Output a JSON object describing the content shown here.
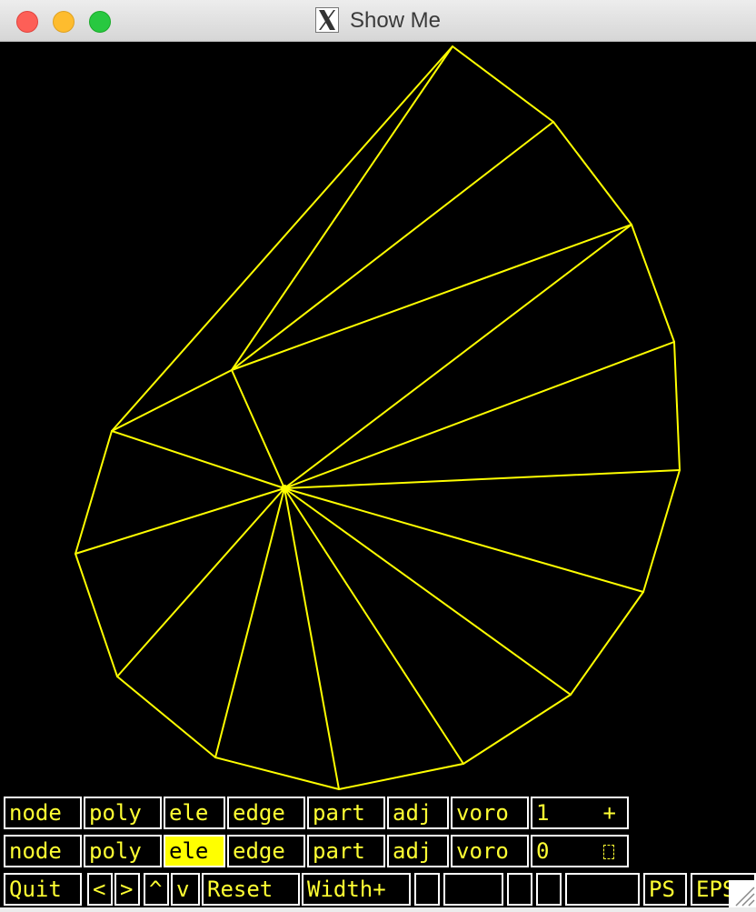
{
  "window": {
    "title": "Show Me"
  },
  "colors": {
    "mesh": "#ffff00",
    "background": "#000000",
    "button_border": "#ffffff",
    "button_text": "#ffff33",
    "active_button_bg": "#ffff00"
  },
  "row1": {
    "node": "node",
    "poly": "poly",
    "ele": "ele",
    "edge": "edge",
    "part": "part",
    "adj": "adj",
    "voro": "voro",
    "number": "1",
    "plus": "+"
  },
  "row2": {
    "node": "node",
    "poly": "poly",
    "ele": "ele",
    "edge": "edge",
    "part": "part",
    "adj": "adj",
    "voro": "voro",
    "number": "0"
  },
  "row3": {
    "quit": "Quit",
    "left": "<",
    "right": ">",
    "up": "^",
    "down": "v",
    "reset": "Reset",
    "width_plus": "Width+",
    "ps": "PS",
    "eps": "EPS"
  },
  "active_button": "row2-ele"
}
